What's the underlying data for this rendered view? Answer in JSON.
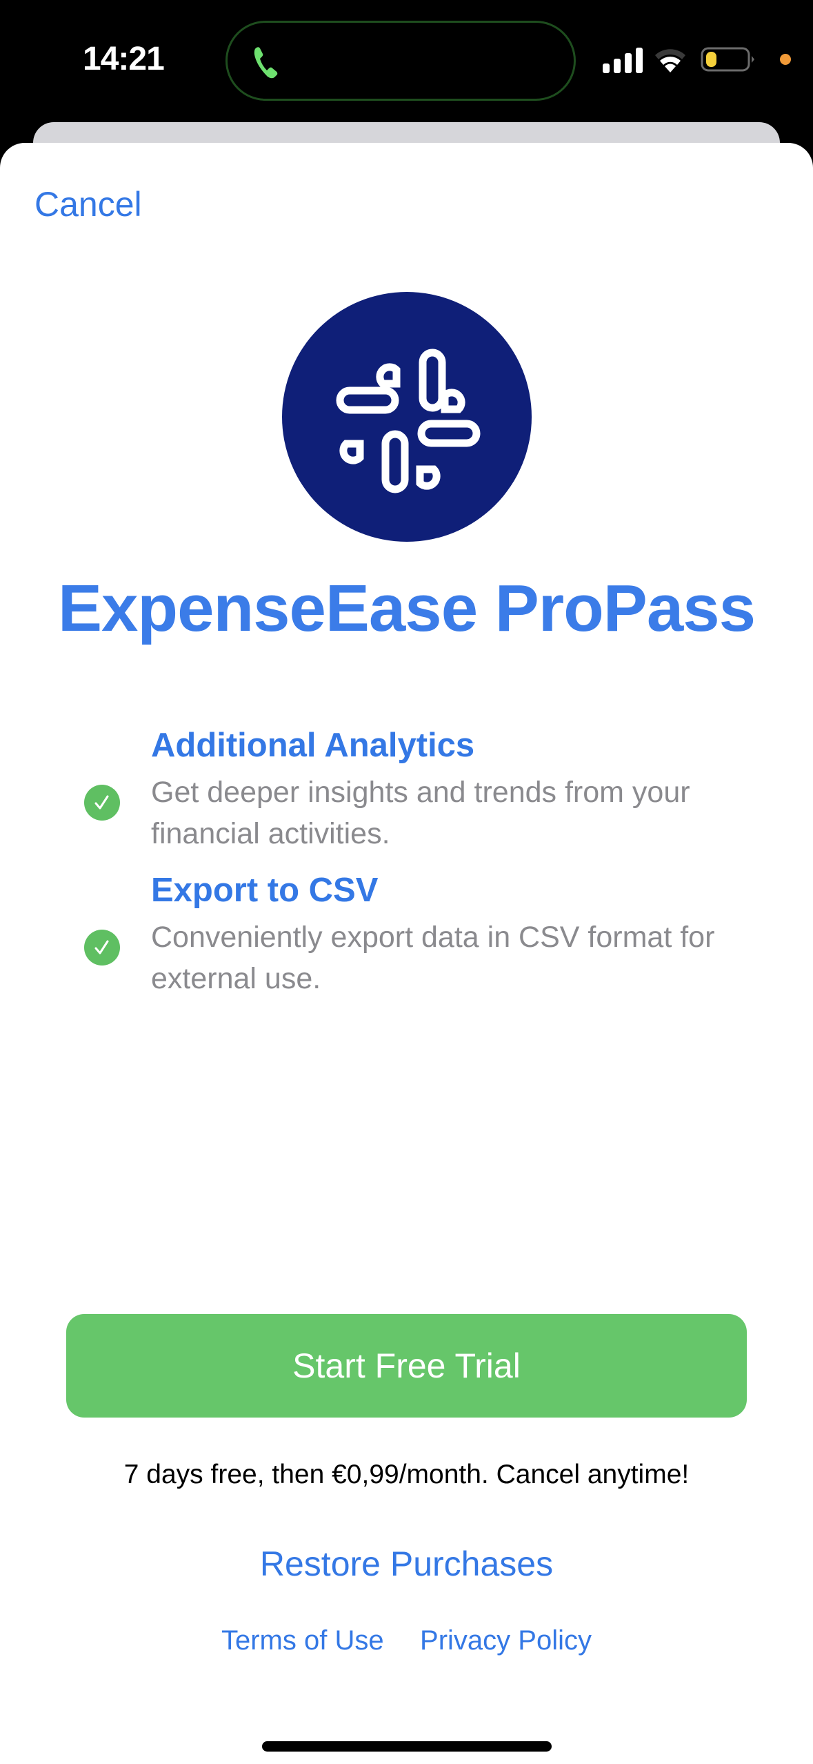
{
  "status_bar": {
    "time": "14:21",
    "call_active": true,
    "signal_bars": 4,
    "battery_level": 0.2,
    "battery_color": "#f5d03b",
    "call_color": "#6ee06f",
    "privacy_dot_color": "#f19a38"
  },
  "sheet": {
    "cancel_label": "Cancel",
    "app_name": "ExpenseEase ProPass",
    "features": [
      {
        "title": "Additional Analytics",
        "description": "Get deeper insights and trends from your financial activities."
      },
      {
        "title": "Export to CSV",
        "description": "Conveniently export data in CSV format for external use."
      }
    ],
    "cta_label": "Start Free Trial",
    "pricing_text": "7 days free, then €0,99/month. Cancel anytime!",
    "restore_label": "Restore Purchases",
    "terms_label": "Terms of Use",
    "privacy_label": "Privacy Policy"
  },
  "colors": {
    "accent": "#3478e5",
    "title": "#3b7ce8",
    "cta": "#66c66a",
    "check": "#5fbf62",
    "logo_bg": "#0f1f78",
    "description": "#8a8a8e"
  }
}
